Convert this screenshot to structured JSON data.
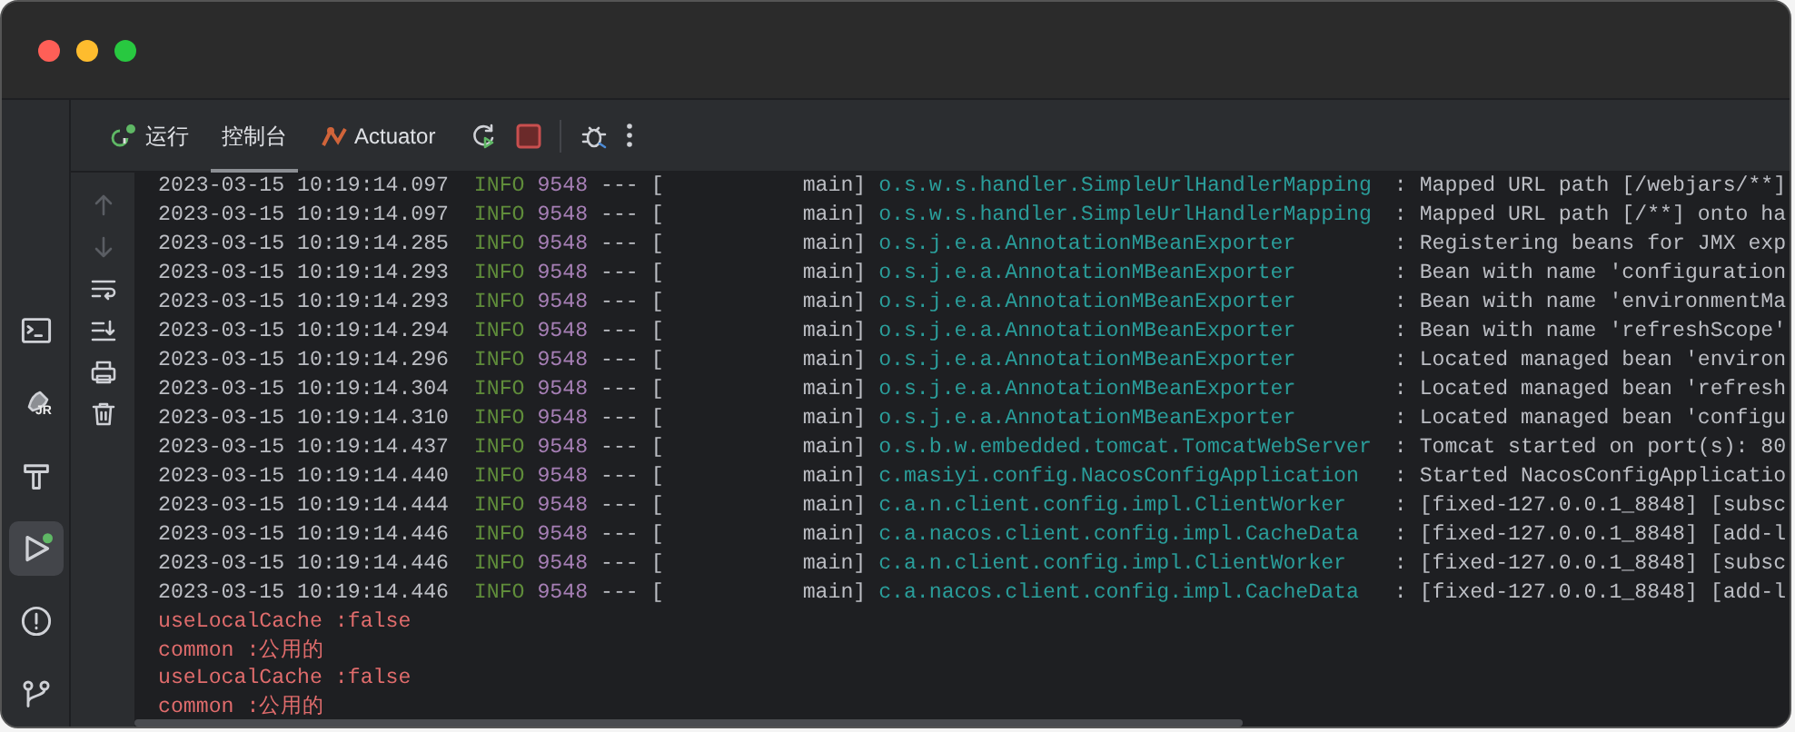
{
  "toolbar": {
    "tabs": [
      {
        "label": "运行",
        "kind": "run",
        "selected": false
      },
      {
        "label": "控制台",
        "kind": "plain",
        "selected": true
      },
      {
        "label": "Actuator",
        "kind": "actuator",
        "selected": false
      }
    ]
  },
  "sidebar": {
    "items": [
      {
        "kind": "terminal",
        "selected": false
      },
      {
        "kind": "rocket",
        "selected": false,
        "badge": "JR"
      },
      {
        "kind": "build",
        "selected": false
      },
      {
        "kind": "run",
        "selected": true
      },
      {
        "kind": "problems",
        "selected": false
      },
      {
        "kind": "git",
        "selected": false
      }
    ]
  },
  "console": {
    "lines": [
      {
        "kind": "log",
        "time": "2023-03-15 10:19:14.097",
        "level": "INFO",
        "pid": "9548",
        "sep": "---",
        "thread": "[           main]",
        "logger": "o.s.w.s.handler.SimpleUrlHandlerMapping",
        "message": ": Mapped URL path [/webjars/**]"
      },
      {
        "kind": "log",
        "time": "2023-03-15 10:19:14.097",
        "level": "INFO",
        "pid": "9548",
        "sep": "---",
        "thread": "[           main]",
        "logger": "o.s.w.s.handler.SimpleUrlHandlerMapping",
        "message": ": Mapped URL path [/**] onto ha"
      },
      {
        "kind": "log",
        "time": "2023-03-15 10:19:14.285",
        "level": "INFO",
        "pid": "9548",
        "sep": "---",
        "thread": "[           main]",
        "logger": "o.s.j.e.a.AnnotationMBeanExporter",
        "message": ": Registering beans for JMX exp"
      },
      {
        "kind": "log",
        "time": "2023-03-15 10:19:14.293",
        "level": "INFO",
        "pid": "9548",
        "sep": "---",
        "thread": "[           main]",
        "logger": "o.s.j.e.a.AnnotationMBeanExporter",
        "message": ": Bean with name 'configuration"
      },
      {
        "kind": "log",
        "time": "2023-03-15 10:19:14.293",
        "level": "INFO",
        "pid": "9548",
        "sep": "---",
        "thread": "[           main]",
        "logger": "o.s.j.e.a.AnnotationMBeanExporter",
        "message": ": Bean with name 'environmentMa"
      },
      {
        "kind": "log",
        "time": "2023-03-15 10:19:14.294",
        "level": "INFO",
        "pid": "9548",
        "sep": "---",
        "thread": "[           main]",
        "logger": "o.s.j.e.a.AnnotationMBeanExporter",
        "message": ": Bean with name 'refreshScope'"
      },
      {
        "kind": "log",
        "time": "2023-03-15 10:19:14.296",
        "level": "INFO",
        "pid": "9548",
        "sep": "---",
        "thread": "[           main]",
        "logger": "o.s.j.e.a.AnnotationMBeanExporter",
        "message": ": Located managed bean 'environ"
      },
      {
        "kind": "log",
        "time": "2023-03-15 10:19:14.304",
        "level": "INFO",
        "pid": "9548",
        "sep": "---",
        "thread": "[           main]",
        "logger": "o.s.j.e.a.AnnotationMBeanExporter",
        "message": ": Located managed bean 'refresh"
      },
      {
        "kind": "log",
        "time": "2023-03-15 10:19:14.310",
        "level": "INFO",
        "pid": "9548",
        "sep": "---",
        "thread": "[           main]",
        "logger": "o.s.j.e.a.AnnotationMBeanExporter",
        "message": ": Located managed bean 'configu"
      },
      {
        "kind": "log",
        "time": "2023-03-15 10:19:14.437",
        "level": "INFO",
        "pid": "9548",
        "sep": "---",
        "thread": "[           main]",
        "logger": "o.s.b.w.embedded.tomcat.TomcatWebServer",
        "message": ": Tomcat started on port(s): 80"
      },
      {
        "kind": "log",
        "time": "2023-03-15 10:19:14.440",
        "level": "INFO",
        "pid": "9548",
        "sep": "---",
        "thread": "[           main]",
        "logger": "c.masiyi.config.NacosConfigApplication",
        "message": ": Started NacosConfigApplicatio"
      },
      {
        "kind": "log",
        "time": "2023-03-15 10:19:14.444",
        "level": "INFO",
        "pid": "9548",
        "sep": "---",
        "thread": "[           main]",
        "logger": "c.a.n.client.config.impl.ClientWorker",
        "message": ": [fixed-127.0.0.1_8848] [subsc"
      },
      {
        "kind": "log",
        "time": "2023-03-15 10:19:14.446",
        "level": "INFO",
        "pid": "9548",
        "sep": "---",
        "thread": "[           main]",
        "logger": "c.a.nacos.client.config.impl.CacheData",
        "message": ": [fixed-127.0.0.1_8848] [add-l"
      },
      {
        "kind": "log",
        "time": "2023-03-15 10:19:14.446",
        "level": "INFO",
        "pid": "9548",
        "sep": "---",
        "thread": "[           main]",
        "logger": "c.a.n.client.config.impl.ClientWorker",
        "message": ": [fixed-127.0.0.1_8848] [subsc"
      },
      {
        "kind": "log",
        "time": "2023-03-15 10:19:14.446",
        "level": "INFO",
        "pid": "9548",
        "sep": "---",
        "thread": "[           main]",
        "logger": "c.a.nacos.client.config.impl.CacheData",
        "message": ": [fixed-127.0.0.1_8848] [add-l"
      },
      {
        "kind": "out",
        "text": "useLocalCache :false"
      },
      {
        "kind": "out",
        "text": "common :公用的"
      },
      {
        "kind": "out",
        "text": "useLocalCache :false"
      },
      {
        "kind": "out",
        "text": "common :公用的"
      }
    ]
  }
}
